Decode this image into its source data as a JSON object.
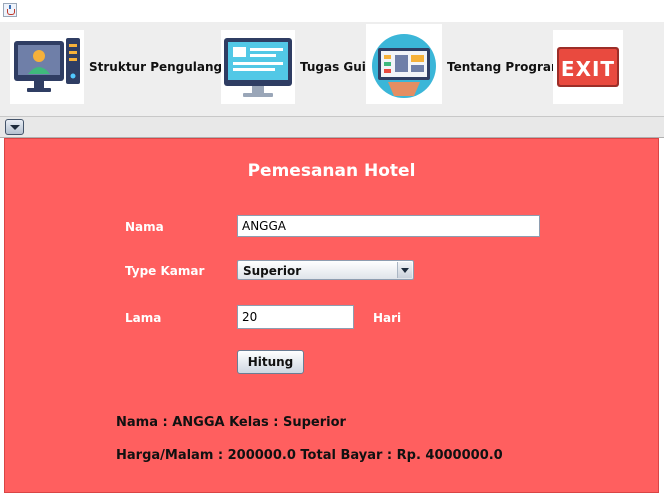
{
  "toolbar": {
    "buttons": [
      {
        "label": "Struktur Pengulangan"
      },
      {
        "label": "Tugas Gui"
      },
      {
        "label": "Tentang Program"
      },
      {
        "label": "EXIT"
      }
    ]
  },
  "form": {
    "title": "Pemesanan Hotel",
    "nama_label": "Nama",
    "nama_value": "ANGGA",
    "type_label": "Type Kamar",
    "type_value": "Superior",
    "lama_label": "Lama",
    "lama_value": "20",
    "hari_label": "Hari",
    "hitung_label": "Hitung"
  },
  "result": {
    "line1": "Nama : ANGGA Kelas : Superior",
    "line2": "Harga/Malam : 200000.0 Total Bayar : Rp. 4000000.0"
  },
  "colors": {
    "panel_bg": "#ff5f5f",
    "exit_red": "#e94a3f"
  },
  "icons": [
    "java-app-icon",
    "desktop-user-icon",
    "monitor-document-icon",
    "dashboard-panel-icon",
    "exit-sign-icon",
    "internal-frame-menu-icon"
  ]
}
